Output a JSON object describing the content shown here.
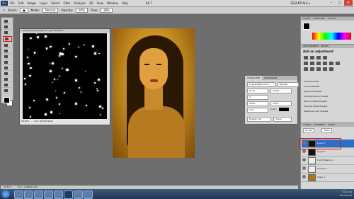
{
  "menubar": {
    "logo": "Ps",
    "menus": [
      "File",
      "Edit",
      "Image",
      "Layer",
      "Select",
      "Filter",
      "Analysis",
      "3D",
      "View",
      "Window",
      "Help"
    ],
    "zoom": "66.7",
    "workspace": "ESSENTIALS ▾"
  },
  "options": {
    "brush_label": "Brush:",
    "mode_label": "Mode:",
    "mode_value": "Normal",
    "opacity_label": "Opacity:",
    "opacity_value": "90%",
    "flow_label": "Flow:",
    "flow_value": "28%"
  },
  "doc1": {
    "title": "pad @ 46.7% (Layer 0, Layer Mask/8) *",
    "zoom": "46.67%",
    "doc_size": "Doc: 667K/8.94M"
  },
  "char_panel": {
    "tabs": [
      "CHARACTER",
      "PARAGRAPH"
    ],
    "font": "Copperplate Goth...",
    "style": "Regular",
    "size": "10 pt",
    "leading": "(Auto)",
    "tracking_label": "0",
    "scale_v": "100%",
    "scale_h": "100%",
    "color_label": "Color:",
    "baseline": "0 pt",
    "language": "English: UK",
    "aa": "Sharp"
  },
  "color_panel": {
    "tabs": [
      "COLOR",
      "SWATCHES",
      "STYLES"
    ]
  },
  "adjustments": {
    "tabs": [
      "ADJUSTMENTS",
      "MASKS"
    ],
    "title": "Add an adjustment",
    "presets": [
      "Levels Presets",
      "Curves Presets",
      "Exposure Presets",
      "Hue/Saturation Presets",
      "Black & White Presets",
      "Channel Mixer Presets",
      "Selective Color Presets"
    ]
  },
  "layers": {
    "tabs": [
      "LAYERS",
      "CHANNELS",
      "PATHS"
    ],
    "blend": "Screen",
    "opacity": "100%",
    "items": [
      "Layer 4",
      "Layer 3",
      "Color Balance 1",
      "Curves 2",
      "Layer 1"
    ]
  },
  "status": {
    "zoom": "66.67%",
    "doc": "Doc: 1.08M/21.0M"
  },
  "taskbar": {
    "time": "下午 4:11",
    "date": "2011-06-26"
  }
}
